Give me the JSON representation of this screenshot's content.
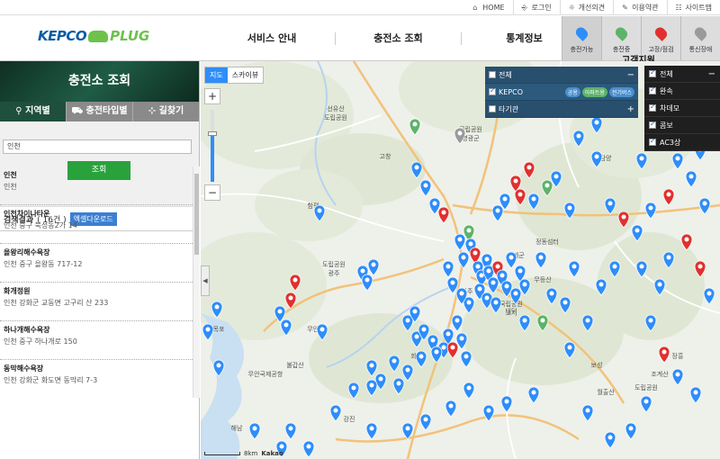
{
  "util_bar": [
    {
      "icon": "home-icon",
      "label": "HOME"
    },
    {
      "icon": "login-icon",
      "label": "로그인"
    },
    {
      "icon": "lightbulb-icon",
      "label": "개선의견"
    },
    {
      "icon": "pencil-icon",
      "label": "이용약관"
    },
    {
      "icon": "sitemap-icon",
      "label": "사이트맵"
    }
  ],
  "logo": {
    "left": "KEPCO",
    "right": "PLUG"
  },
  "nav": [
    "서비스 안내",
    "충전소 조회",
    "통계정보"
  ],
  "status_buttons": [
    {
      "label": "충전가능",
      "color": "#2f8dfa"
    },
    {
      "label": "충전중",
      "color": "#5db36a"
    },
    {
      "label": "고장/점검",
      "color": "#e0312f"
    },
    {
      "label": "통신장애",
      "color": "#9a9a9a"
    }
  ],
  "tooltip": "고객지원",
  "panel": {
    "title": "충전소 조회",
    "tabs": [
      {
        "label": "지역별",
        "icon": "pin-icon"
      },
      {
        "label": "충전타입별",
        "icon": "car-icon"
      },
      {
        "label": "길찾기",
        "icon": "signpost-icon"
      }
    ],
    "search_value": "인천",
    "search_button": "조회",
    "result_label": "검색결과",
    "result_count": "( 16건 )",
    "excel_button": "엑셀다운로드",
    "results": [
      {
        "name": "인천",
        "addr": "인천"
      },
      {
        "name": "인천차이나타운",
        "addr": "인천 중구 북성동2가 14"
      },
      {
        "name": "을왕리해수욕장",
        "addr": "인천 중구 을왕동 717-12"
      },
      {
        "name": "화개정원",
        "addr": "인천 강화군 교동면 고구리 산 233"
      },
      {
        "name": "하나개해수욕장",
        "addr": "인천 중구 하나개로 150"
      },
      {
        "name": "동막해수욕장",
        "addr": "인천 강화군 화도면 동막리 7-3"
      }
    ]
  },
  "map": {
    "type_buttons": [
      "지도",
      "스카이뷰"
    ],
    "zoom_in": "+",
    "zoom_out": "−",
    "layers": {
      "all_label": "전체",
      "kepco_label": "KEPCO",
      "chips": [
        "공용",
        "아파트용",
        "전기버스"
      ],
      "other_label": "타기관",
      "collapse_sign": "−",
      "expand_sign": "+"
    },
    "filters": {
      "items": [
        "전체",
        "완속",
        "차데모",
        "콤보",
        "AC3상"
      ],
      "collapse_sign": "−"
    },
    "scale_label": "8km",
    "provider": "Kakao",
    "place_labels": [
      "선유산",
      "도립공원",
      "고창",
      "국립공원",
      "영광군",
      "함평",
      "무안군",
      "불갑산",
      "도립공원",
      "광주",
      "나주",
      "화순",
      "대덕",
      "정동섬터",
      "무등산",
      "국립공원",
      "고서",
      "구례군",
      "보성",
      "장흥",
      "조계산",
      "도립공원",
      "월출산",
      "해남",
      "무안국제공항",
      "목포",
      "강진",
      "담양"
    ]
  }
}
